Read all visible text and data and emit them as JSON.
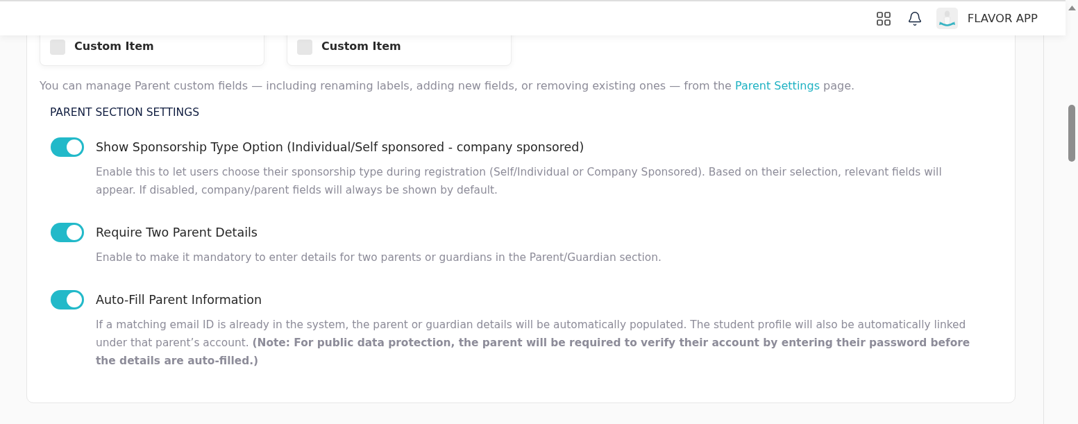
{
  "header": {
    "app_name": "FLAVOR APP"
  },
  "custom_items": [
    {
      "label": "Custom Item",
      "checked": false
    },
    {
      "label": "Custom Item",
      "checked": false
    }
  ],
  "note": {
    "text_before": "You can manage Parent custom fields — including renaming labels, adding new fields, or removing existing ones — from the ",
    "link": "Parent Settings",
    "text_after": " page."
  },
  "section": {
    "title": "PARENT SECTION SETTINGS",
    "settings": [
      {
        "title": "Show Sponsorship Type Option (Individual/Self sponsored - company sponsored)",
        "description": "Enable this to let users choose their sponsorship type during registration (Self/Individual or Company Sponsored). Based on their selection, relevant fields will appear. If disabled, company/parent fields will always be shown by default.",
        "on": true
      },
      {
        "title": "Require Two Parent Details",
        "description": "Enable to make it mandatory to enter details for two parents or guardians in the Parent/Guardian section.",
        "on": true
      },
      {
        "title": "Auto-Fill Parent Information",
        "description": "If a matching email ID is already in the system, the parent or guardian details will be automatically populated. The student profile will also be automatically linked under that parent’s account. **(Note: For public data protection, the parent will be required to verify their account by entering their password before the details are auto-filled.)**",
        "on": true
      }
    ]
  }
}
